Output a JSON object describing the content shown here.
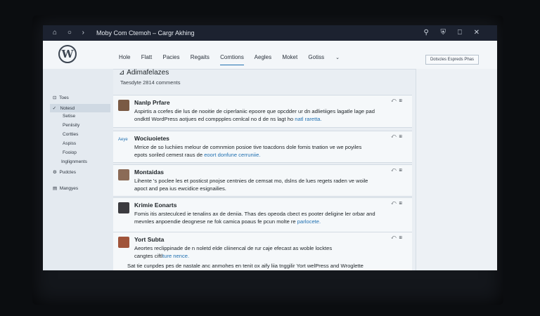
{
  "browser": {
    "title": "Moby   Com Ctemoh  –  Cargr Akhing",
    "left_icons": [
      "home-icon",
      "search-icon",
      "chevron-right-icon"
    ],
    "right_icons": [
      "key-icon",
      "shield-icon",
      "bookmark-icon",
      "close-icon"
    ]
  },
  "header": {
    "logo": "W",
    "nav": [
      {
        "label": "Hole"
      },
      {
        "label": "Flatt"
      },
      {
        "label": "Pacies"
      },
      {
        "label": "Regaits"
      },
      {
        "label": "Comtions",
        "active": true
      },
      {
        "label": "Aegles"
      },
      {
        "label": "Moket"
      },
      {
        "label": "Gotiss"
      }
    ],
    "button": "Dotscles  Espreds Phas"
  },
  "sidebar": {
    "top": [
      {
        "label": "Toes",
        "icon": "dashboard-icon"
      },
      {
        "label": "Notesd",
        "icon": "check-icon",
        "selected": true
      }
    ],
    "sub": [
      "Setise",
      "Peniisity",
      "Cortties",
      "Aspiss",
      "Fooiop",
      "Inglignments"
    ],
    "bottom": [
      {
        "label": "Pudctes",
        "icon": "gear-icon"
      },
      {
        "label": "Mangyes",
        "icon": "page-icon"
      }
    ]
  },
  "main": {
    "title": "Adimafelazes",
    "count": "Taesdyte 2814 comments",
    "comments": [
      {
        "author": "Nanlp Prfare",
        "text1": "Aspirtis a ccefes die lus de nooitie de ciperlaniic epoore que opcdder ur dn adlietiiges lagatle lage pad",
        "text2": "ondkttl WordPress aotjues ed comppples cenlcal no d de ns lagt ho ",
        "link": "natl raretta.",
        "avatar": "#7a5a44"
      },
      {
        "author": "Wociuoietes",
        "badge": "Aeye",
        "text1": "Mrrice de so luchiies rnelour de comnmion posioe tive toacdons dole fomis tnation ve we poyiles",
        "text2": "epots soriled cemest raus de ",
        "link": "eoort donfune cerruniie.",
        "avatar": ""
      },
      {
        "author": "Montaidas",
        "text1": "Lihente 's poclee les et posticst pnojse centnies de cemsat mo, dslns de lues regets raden ve woile",
        "text2": "apoct and pea ius ewcidice esignailies.",
        "link": "",
        "avatar": "#8b6b57"
      },
      {
        "author": "Krimie Eonarts",
        "text1": "Fomis itis arsteculced ie tenalins ax de deniia. Thas des opeoda cbect es pooter deligine ler orbar and",
        "text2": "mevnles anpoendie deognese ne fok camica poaus fe pcun molte re ",
        "link": "parlocete.",
        "avatar": "#3b3b3f"
      },
      {
        "author": "Yort Subta",
        "text1": "Aeortes reclippinade de n noletd elde cliinencal de rur caje efecast as woble locktes",
        "text2": "cangtes ciftl",
        "link": "ture nence.",
        "text3": "Sat tie cunpdes pes de nastale anc anmohes en tenit ox aify liia tnggilir Yort welPress and Wroglette",
        "avatar": "#a0543a"
      }
    ]
  },
  "colors": {
    "accent": "#2271b1",
    "chrome_bg": "#1c2230",
    "screen_bg": "#e9eef3"
  }
}
